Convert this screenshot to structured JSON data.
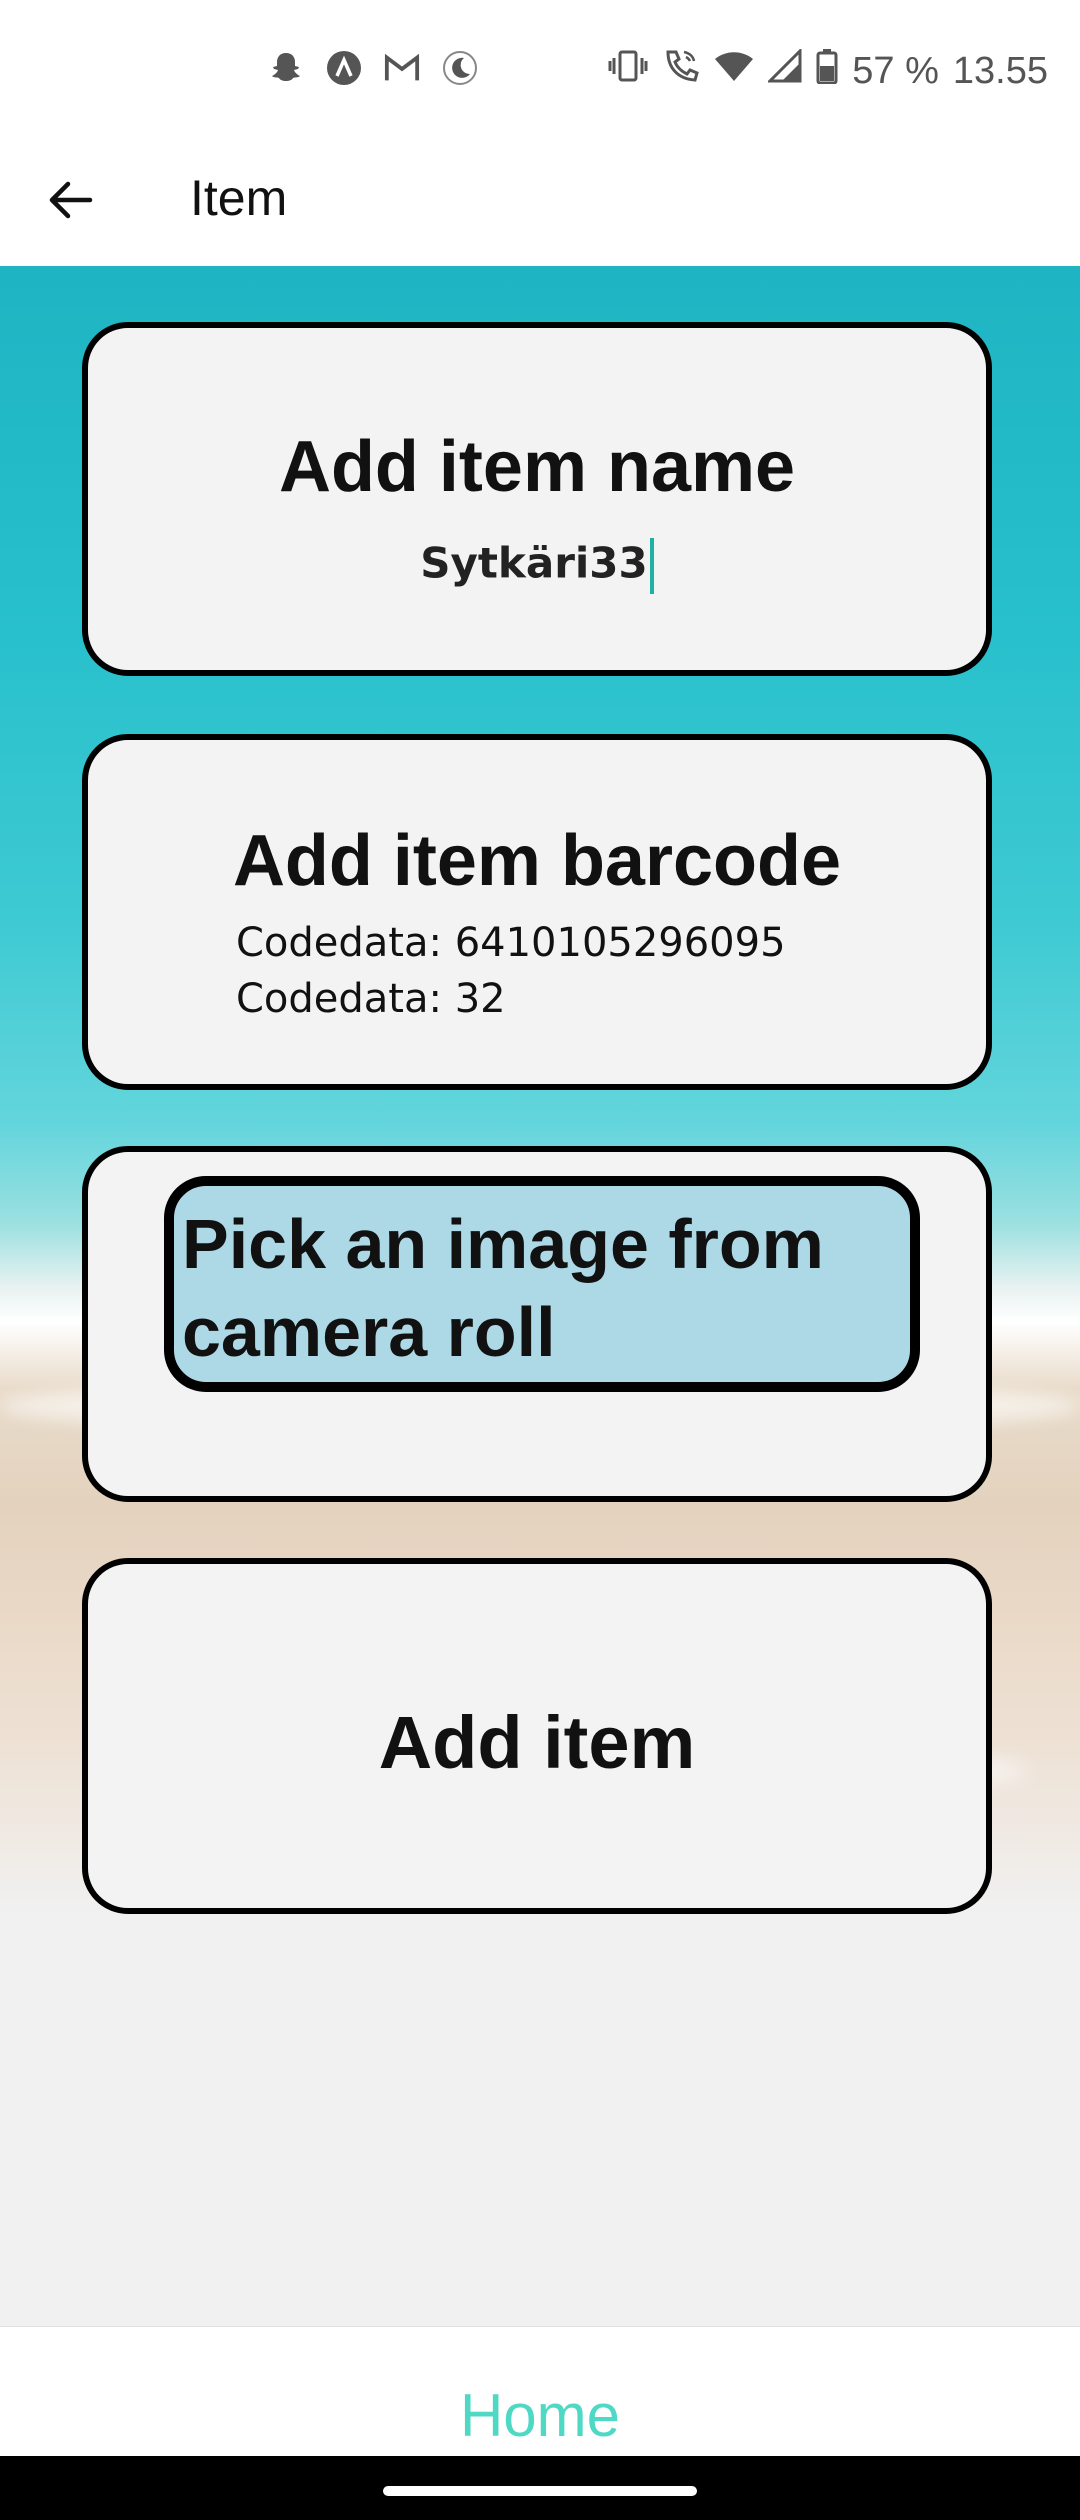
{
  "status_bar": {
    "left_icons": [
      "snapchat-icon",
      "app-a-icon",
      "gmail-icon",
      "moon-icon"
    ],
    "right_icons": [
      "vibrate-icon",
      "wifi-call-icon",
      "wifi-icon",
      "signal-icon",
      "battery-icon"
    ],
    "battery": "57 %",
    "time": "13.55"
  },
  "app_bar": {
    "title": "Item"
  },
  "cards": {
    "name": {
      "title": "Add item name",
      "value": "Sytkäri33"
    },
    "barcode": {
      "title": "Add item barcode",
      "line1": "Codedata: 6410105296095",
      "line2": "Codedata: 32"
    },
    "image": {
      "button_label": "Pick an image from camera roll"
    },
    "add": {
      "title": "Add item"
    }
  },
  "tab_bar": {
    "home_label": "Home",
    "home_color": "#4fd9c4"
  },
  "colors": {
    "pick_button_bg": "#add8e6",
    "caret": "#1fb1a6"
  }
}
